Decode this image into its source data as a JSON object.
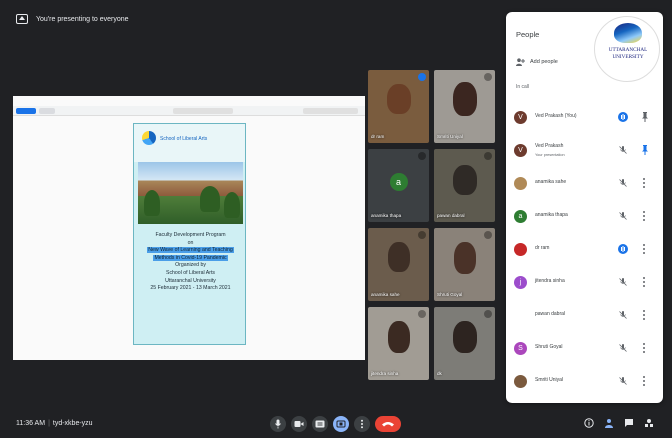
{
  "banner": {
    "text": "You're presenting to everyone"
  },
  "poster": {
    "school": "School of Liberal Arts",
    "line1": "Faculty Development Program",
    "line2": "on",
    "line3": "New Wave of Learning and Teaching",
    "line4": "Methods in Covid-19 Pandemic",
    "line5": "Organized by",
    "line6": "School of Liberal Arts",
    "line7": "Uttaranchal University",
    "line8": "25 February 2021 - 13 March 2021"
  },
  "tiles": [
    {
      "name": "dr ram"
    },
    {
      "name": "Smriti Uniyal"
    },
    {
      "name": "anamika thapa",
      "initial": "a"
    },
    {
      "name": "pawan dabral"
    },
    {
      "name": "anamika sahe"
    },
    {
      "name": "Shruti Goyal"
    },
    {
      "name": "jitendra sinha"
    },
    {
      "name": "dk"
    }
  ],
  "bottom": {
    "time": "11:36 AM",
    "code": "tyd-xkbe-yzu"
  },
  "panel": {
    "title": "People",
    "add_people": "Add people",
    "in_call": "In call",
    "logo_text": "UTTARANCHAL UNIVERSITY",
    "people": [
      {
        "name": "Ved Prakash (You)",
        "avatar": "V",
        "color": "#6d3b2e"
      },
      {
        "name": "Ved Prakash",
        "sub": "Your presentation",
        "avatar": "V",
        "color": "#6d3b2e"
      },
      {
        "name": "anamika sahe",
        "avatar": "",
        "color": "#b08a57"
      },
      {
        "name": "anamika thapa",
        "avatar": "a",
        "color": "#2e7d32"
      },
      {
        "name": "dr ram",
        "avatar": "",
        "color": "#c62828"
      },
      {
        "name": "jitendra sinha",
        "avatar": "j",
        "color": "#9c4dcc"
      },
      {
        "name": "pawan dabral",
        "avatar": "",
        "color": "#ffffff"
      },
      {
        "name": "Shruti Goyal",
        "avatar": "S",
        "color": "#ab47bc"
      },
      {
        "name": "Smriti Uniyal",
        "avatar": "",
        "color": "#7b5a3e"
      }
    ]
  }
}
